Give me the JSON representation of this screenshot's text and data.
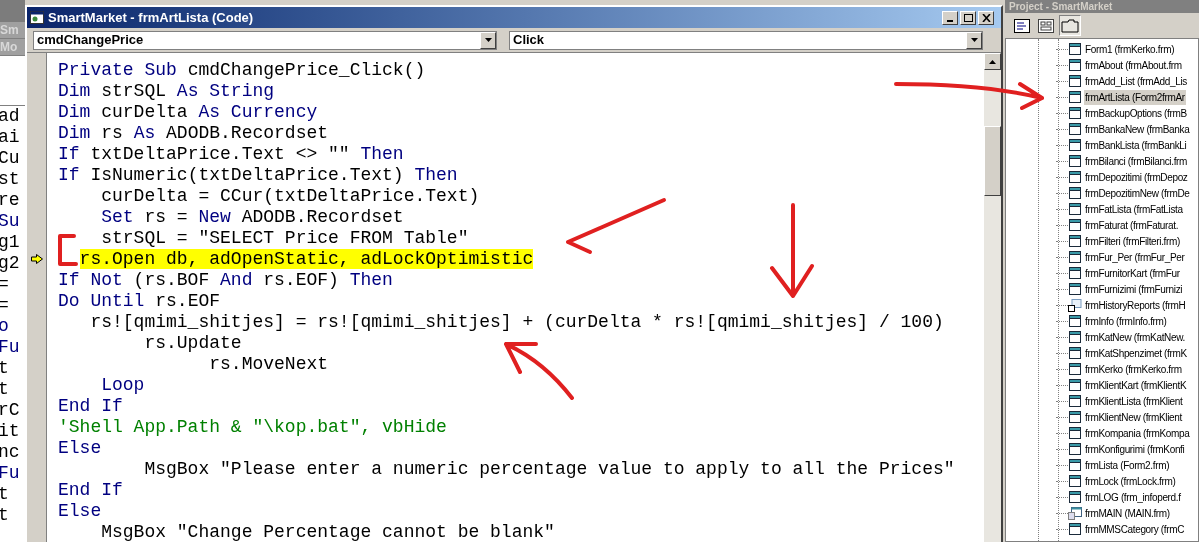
{
  "background_window": {
    "tabs": [
      {
        "label": "Sm"
      },
      {
        "label": "Mo"
      }
    ],
    "fragments": [
      {
        "text": "ad",
        "kind": "plain"
      },
      {
        "text": "ai",
        "kind": "plain"
      },
      {
        "text": "Cu",
        "kind": "plain"
      },
      {
        "text": "st",
        "kind": "plain"
      },
      {
        "text": "re",
        "kind": "plain"
      },
      {
        "text": "Su",
        "kind": "keyword"
      },
      {
        "text": "g1",
        "kind": "plain"
      },
      {
        "text": "g2",
        "kind": "plain"
      },
      {
        "text": "=",
        "kind": "plain"
      },
      {
        "text": "=",
        "kind": "plain"
      },
      {
        "text": "o",
        "kind": "keyword"
      },
      {
        "text": "Fu",
        "kind": "keyword"
      },
      {
        "text": "t",
        "kind": "plain"
      },
      {
        "text": "t",
        "kind": "plain"
      },
      {
        "text": "rC",
        "kind": "plain"
      },
      {
        "text": "it",
        "kind": "plain"
      },
      {
        "text": "nc",
        "kind": "plain"
      },
      {
        "text": "Fu",
        "kind": "keyword"
      },
      {
        "text": "t",
        "kind": "plain"
      },
      {
        "text": "t",
        "kind": "plain"
      }
    ]
  },
  "code_window": {
    "title": "SmartMarket - frmArtLista (Code)",
    "object_dropdown": "cmdChangePrice",
    "procedure_dropdown": "Click",
    "lines": [
      {
        "current": false,
        "tokens": [
          {
            "kind": "keyword",
            "text": "Private Sub"
          },
          {
            "kind": "plain",
            "text": " cmdChangePrice_Click()"
          }
        ]
      },
      {
        "current": false,
        "tokens": [
          {
            "kind": "keyword",
            "text": "Dim"
          },
          {
            "kind": "plain",
            "text": " strSQL "
          },
          {
            "kind": "keyword",
            "text": "As String"
          }
        ]
      },
      {
        "current": false,
        "tokens": [
          {
            "kind": "keyword",
            "text": "Dim"
          },
          {
            "kind": "plain",
            "text": " curDelta "
          },
          {
            "kind": "keyword",
            "text": "As Currency"
          }
        ]
      },
      {
        "current": false,
        "tokens": [
          {
            "kind": "keyword",
            "text": "Dim"
          },
          {
            "kind": "plain",
            "text": " rs "
          },
          {
            "kind": "keyword",
            "text": "As"
          },
          {
            "kind": "plain",
            "text": " ADODB.Recordset"
          }
        ]
      },
      {
        "current": false,
        "tokens": [
          {
            "kind": "keyword",
            "text": "If"
          },
          {
            "kind": "plain",
            "text": " txtDeltaPrice.Text <> \"\" "
          },
          {
            "kind": "keyword",
            "text": "Then"
          }
        ]
      },
      {
        "current": false,
        "tokens": [
          {
            "kind": "keyword",
            "text": "If"
          },
          {
            "kind": "plain",
            "text": " IsNumeric(txtDeltaPrice.Text) "
          },
          {
            "kind": "keyword",
            "text": "Then"
          }
        ]
      },
      {
        "current": false,
        "tokens": [
          {
            "kind": "plain",
            "text": "    curDelta = CCur(txtDeltaPrice.Text)"
          }
        ]
      },
      {
        "current": false,
        "tokens": [
          {
            "kind": "keyword",
            "text": "    Set"
          },
          {
            "kind": "plain",
            "text": " rs = "
          },
          {
            "kind": "keyword",
            "text": "New"
          },
          {
            "kind": "plain",
            "text": " ADODB.Recordset"
          }
        ]
      },
      {
        "current": false,
        "tokens": [
          {
            "kind": "plain",
            "text": "    strSQL = \"SELECT Price FROM Table\""
          }
        ]
      },
      {
        "current": true,
        "tokens": [
          {
            "kind": "plain",
            "text": "  rs.Open db, adOpenStatic, adLockOptimistic"
          }
        ]
      },
      {
        "current": false,
        "tokens": [
          {
            "kind": "keyword",
            "text": "If Not"
          },
          {
            "kind": "plain",
            "text": " (rs.BOF "
          },
          {
            "kind": "keyword",
            "text": "And"
          },
          {
            "kind": "plain",
            "text": " rs.EOF) "
          },
          {
            "kind": "keyword",
            "text": "Then"
          }
        ]
      },
      {
        "current": false,
        "tokens": [
          {
            "kind": "keyword",
            "text": "Do Until"
          },
          {
            "kind": "plain",
            "text": " rs.EOF"
          }
        ]
      },
      {
        "current": false,
        "tokens": [
          {
            "kind": "plain",
            "text": "   rs![qmimi_shitjes] = rs![qmimi_shitjes] + (curDelta * rs![qmimi_shitjes] / 100)"
          }
        ]
      },
      {
        "current": false,
        "tokens": [
          {
            "kind": "plain",
            "text": "        rs.Update"
          }
        ]
      },
      {
        "current": false,
        "tokens": [
          {
            "kind": "plain",
            "text": "              rs.MoveNext"
          }
        ]
      },
      {
        "current": false,
        "tokens": [
          {
            "kind": "keyword",
            "text": "    Loop"
          }
        ]
      },
      {
        "current": false,
        "tokens": [
          {
            "kind": "keyword",
            "text": "End If"
          }
        ]
      },
      {
        "current": false,
        "tokens": [
          {
            "kind": "comment",
            "text": "'Shell App.Path & \"\\kop.bat\", vbHide"
          }
        ]
      },
      {
        "current": false,
        "tokens": [
          {
            "kind": "keyword",
            "text": "Else"
          }
        ]
      },
      {
        "current": false,
        "tokens": [
          {
            "kind": "plain",
            "text": "        MsgBox \"Please enter a numeric percentage value to apply to all the Prices\""
          }
        ]
      },
      {
        "current": false,
        "tokens": [
          {
            "kind": "keyword",
            "text": "End If"
          }
        ]
      },
      {
        "current": false,
        "tokens": [
          {
            "kind": "keyword",
            "text": "Else"
          }
        ]
      },
      {
        "current": false,
        "tokens": [
          {
            "kind": "plain",
            "text": "    MsgBox \"Change Percentage cannot be blank\""
          }
        ]
      }
    ]
  },
  "project_panel": {
    "title": "Project - SmartMarket",
    "toolbar": [
      {
        "kind": "code",
        "selected": false
      },
      {
        "kind": "object",
        "selected": false
      },
      {
        "kind": "folders",
        "selected": true
      }
    ],
    "items": [
      {
        "label": "Form1 (frmKerko.frm)",
        "kind": "form",
        "selected": false
      },
      {
        "label": "frmAbout (frmAbout.frm",
        "kind": "form",
        "selected": false
      },
      {
        "label": "frmAdd_List (frmAdd_Lis",
        "kind": "form",
        "selected": false
      },
      {
        "label": "frmArtLista (Form2frmAr",
        "kind": "form",
        "selected": true
      },
      {
        "label": "frmBackupOptions (frmB",
        "kind": "form",
        "selected": false
      },
      {
        "label": "frmBankaNew (frmBanka",
        "kind": "form",
        "selected": false
      },
      {
        "label": "frmBankLista (frmBankLi",
        "kind": "form",
        "selected": false
      },
      {
        "label": "frmBilanci (frmBilanci.frm",
        "kind": "form",
        "selected": false
      },
      {
        "label": "frmDepozitimi (frmDepoz",
        "kind": "form",
        "selected": false
      },
      {
        "label": "frmDepozitimNew (frmDe",
        "kind": "form",
        "selected": false
      },
      {
        "label": "frmFatLista (frmFatLista",
        "kind": "form",
        "selected": false
      },
      {
        "label": "frmFaturat (frmFaturat.",
        "kind": "form",
        "selected": false
      },
      {
        "label": "frmFilteri (frmFilteri.frm)",
        "kind": "form",
        "selected": false
      },
      {
        "label": "frmFur_Per (frmFur_Per",
        "kind": "form",
        "selected": false
      },
      {
        "label": "frmFurnitorKart (frmFur",
        "kind": "form",
        "selected": false
      },
      {
        "label": "frmFurnizimi (frmFurnizi",
        "kind": "form",
        "selected": false
      },
      {
        "label": "frmHistoryReports (frmH",
        "kind": "report",
        "selected": false
      },
      {
        "label": "frmInfo (frmInfo.frm)",
        "kind": "form",
        "selected": false
      },
      {
        "label": "frmKatNew (frmKatNew.",
        "kind": "form",
        "selected": false
      },
      {
        "label": "frmKatShpenzimet (frmK",
        "kind": "form",
        "selected": false
      },
      {
        "label": "frmKerko (frmKerko.frm",
        "kind": "form",
        "selected": false
      },
      {
        "label": "frmKlientKart (frmKlientK",
        "kind": "form",
        "selected": false
      },
      {
        "label": "frmKlientLista (frmKlient",
        "kind": "form",
        "selected": false
      },
      {
        "label": "frmKlientNew (frmKlient",
        "kind": "form",
        "selected": false
      },
      {
        "label": "frmKompania (frmKompa",
        "kind": "form",
        "selected": false
      },
      {
        "label": "frmKonfigurimi (frmKonfi",
        "kind": "form",
        "selected": false
      },
      {
        "label": "frmLista (Form2.frm)",
        "kind": "form",
        "selected": false
      },
      {
        "label": "frmLock (frmLock.frm)",
        "kind": "form",
        "selected": false
      },
      {
        "label": "frmLOG (frm_infoperd.f",
        "kind": "form",
        "selected": false
      },
      {
        "label": "frmMAIN (MAIN.frm)",
        "kind": "mdi",
        "selected": false
      },
      {
        "label": "frmMMSCategory (frmC",
        "kind": "form",
        "selected": false
      }
    ]
  }
}
